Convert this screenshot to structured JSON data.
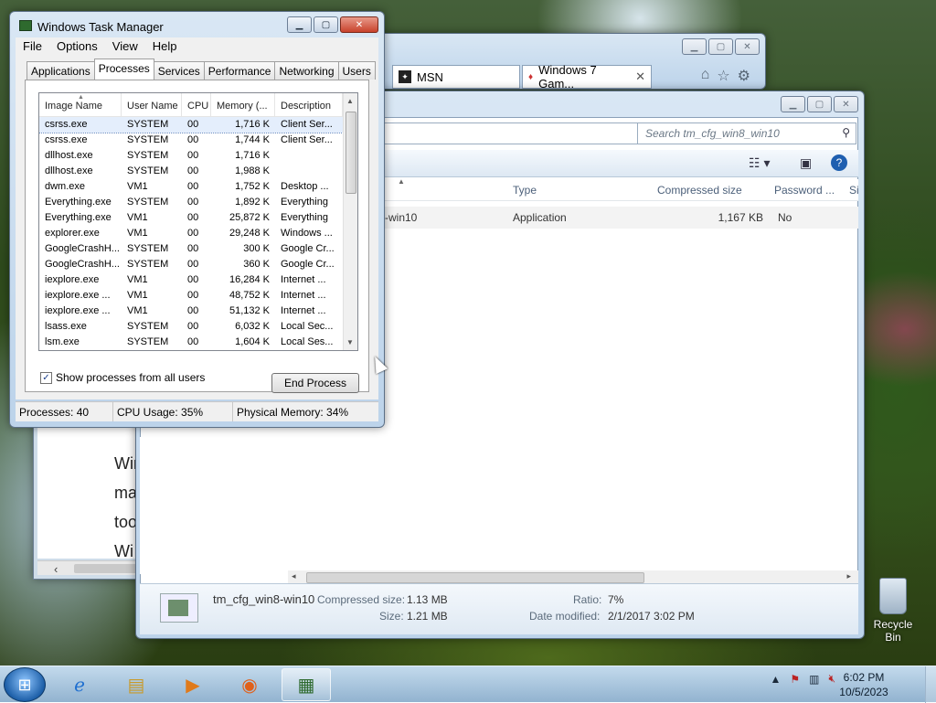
{
  "taskmgr": {
    "title": "Windows Task Manager",
    "menu": [
      "File",
      "Options",
      "View",
      "Help"
    ],
    "tabs": [
      "Applications",
      "Processes",
      "Services",
      "Performance",
      "Networking",
      "Users"
    ],
    "active_tab": 1,
    "columns": [
      "Image Name",
      "User Name",
      "CPU",
      "Memory (...",
      "Description"
    ],
    "processes": [
      {
        "name": "csrss.exe",
        "user": "SYSTEM",
        "cpu": "00",
        "mem": "1,716 K",
        "desc": "Client Ser..."
      },
      {
        "name": "csrss.exe",
        "user": "SYSTEM",
        "cpu": "00",
        "mem": "1,744 K",
        "desc": "Client Ser..."
      },
      {
        "name": "dllhost.exe",
        "user": "SYSTEM",
        "cpu": "00",
        "mem": "1,716 K",
        "desc": ""
      },
      {
        "name": "dllhost.exe",
        "user": "SYSTEM",
        "cpu": "00",
        "mem": "1,988 K",
        "desc": ""
      },
      {
        "name": "dwm.exe",
        "user": "VM1",
        "cpu": "00",
        "mem": "1,752 K",
        "desc": "Desktop ..."
      },
      {
        "name": "Everything.exe",
        "user": "SYSTEM",
        "cpu": "00",
        "mem": "1,892 K",
        "desc": "Everything"
      },
      {
        "name": "Everything.exe",
        "user": "VM1",
        "cpu": "00",
        "mem": "25,872 K",
        "desc": "Everything"
      },
      {
        "name": "explorer.exe",
        "user": "VM1",
        "cpu": "00",
        "mem": "29,248 K",
        "desc": "Windows ..."
      },
      {
        "name": "GoogleCrashH...",
        "user": "SYSTEM",
        "cpu": "00",
        "mem": "300 K",
        "desc": "Google Cr..."
      },
      {
        "name": "GoogleCrashH...",
        "user": "SYSTEM",
        "cpu": "00",
        "mem": "360 K",
        "desc": "Google Cr..."
      },
      {
        "name": "iexplore.exe",
        "user": "VM1",
        "cpu": "00",
        "mem": "16,284 K",
        "desc": "Internet ..."
      },
      {
        "name": "iexplore.exe ...",
        "user": "VM1",
        "cpu": "00",
        "mem": "48,752 K",
        "desc": "Internet ..."
      },
      {
        "name": "iexplore.exe ...",
        "user": "VM1",
        "cpu": "00",
        "mem": "51,132 K",
        "desc": "Internet ..."
      },
      {
        "name": "lsass.exe",
        "user": "SYSTEM",
        "cpu": "00",
        "mem": "6,032 K",
        "desc": "Local Sec..."
      },
      {
        "name": "lsm.exe",
        "user": "SYSTEM",
        "cpu": "00",
        "mem": "1,604 K",
        "desc": "Local Ses..."
      }
    ],
    "show_all_label": "Show processes from all users",
    "end_process_label": "End Process",
    "status": {
      "processes": "Processes: 40",
      "cpu": "CPU Usage: 35%",
      "memory": "Physical Memory: 34%"
    }
  },
  "browser": {
    "tabs": [
      {
        "label": "MSN"
      },
      {
        "label": "Windows 7 Gam..."
      }
    ]
  },
  "archive": {
    "search_placeholder": "Search tm_cfg_win8_win10",
    "columns": [
      "Type",
      "Compressed size",
      "Password ...",
      "Si"
    ],
    "row": {
      "name_tail": "-win10",
      "type": "Application",
      "compressed": "1,167 KB",
      "password": "No"
    },
    "details": {
      "filename": "tm_cfg_win8-win10",
      "compressed_label": "Compressed size:",
      "compressed_value": "1.13 MB",
      "size_label": "Size:",
      "size_value": "1.21 MB",
      "ratio_label": "Ratio:",
      "ratio_value": "7%",
      "modified_label": "Date modified:",
      "modified_value": "2/1/2017 3:02 PM"
    }
  },
  "word_bg": {
    "lines": [
      "Win",
      "mar",
      "too",
      "Wi"
    ]
  },
  "desktop": {
    "recycle_label": "Recycle Bin"
  },
  "taskbar": {
    "time": "6:02 PM",
    "date": "10/5/2023"
  }
}
